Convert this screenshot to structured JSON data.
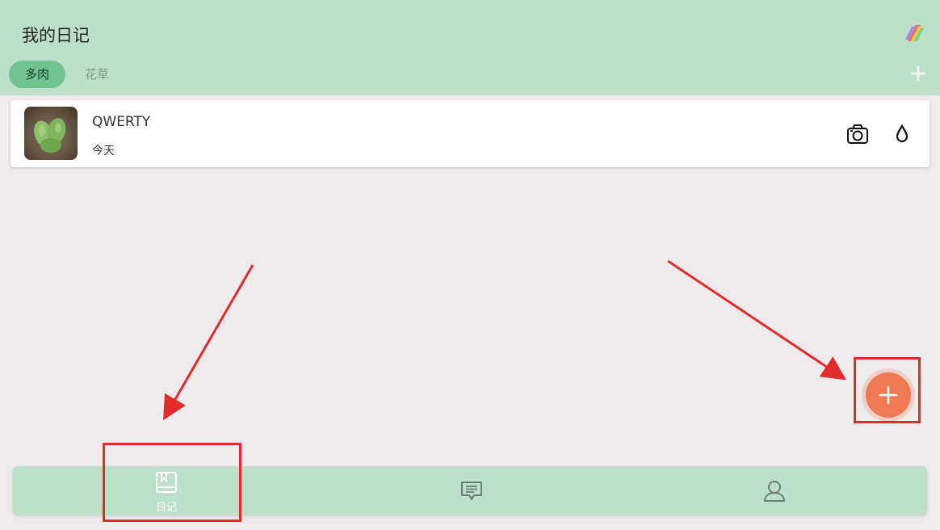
{
  "header": {
    "title": "我的日记"
  },
  "tabs": [
    {
      "label": "多肉",
      "active": true
    },
    {
      "label": "花草",
      "active": false
    }
  ],
  "plants": [
    {
      "name": "QWERTY",
      "date": "今天"
    }
  ],
  "bottom_nav": {
    "items": [
      {
        "label": "日记",
        "icon": "diary-book-icon",
        "active": true
      },
      {
        "icon": "message-icon"
      },
      {
        "icon": "profile-icon"
      }
    ]
  },
  "colors": {
    "header_bg": "#bde0cb",
    "tab_active": "#6fc38f",
    "fab": "#ef7a52",
    "annotation": "#e22b2b",
    "background": "#efebec"
  }
}
